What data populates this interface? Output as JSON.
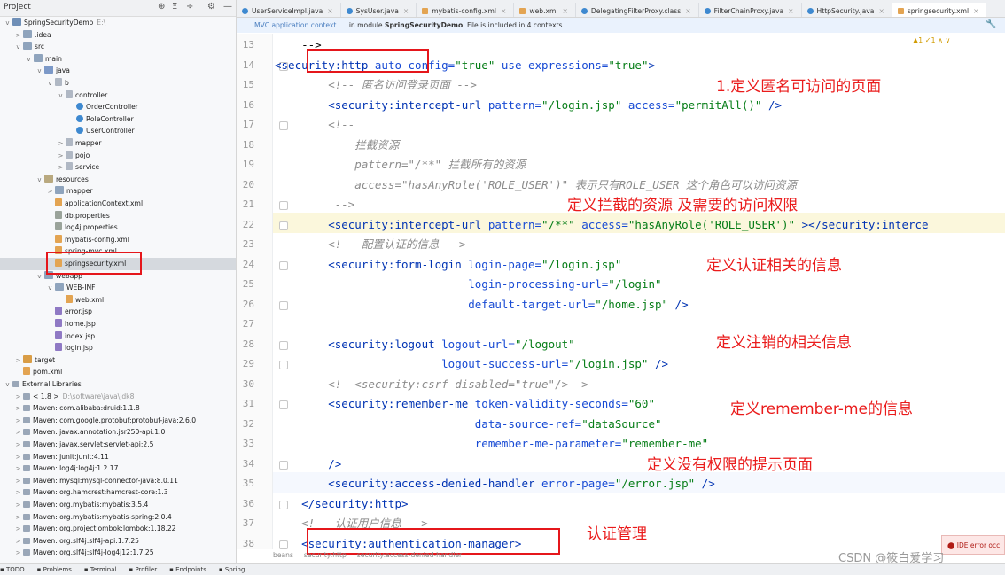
{
  "project_panel": {
    "header_title": "Project",
    "toolbar": [
      "⊕",
      "Ξ",
      "÷",
      "⚙",
      "—"
    ],
    "tree": [
      {
        "label": "SpringSecurityDemo",
        "suffix": "E:\\",
        "depth": 0,
        "icon": "module-folder",
        "twisty": "v"
      },
      {
        "label": ".idea",
        "depth": 1,
        "icon": "folder",
        "twisty": ">"
      },
      {
        "label": "src",
        "depth": 1,
        "icon": "folder",
        "twisty": "v"
      },
      {
        "label": "main",
        "depth": 2,
        "icon": "folder",
        "twisty": "v"
      },
      {
        "label": "java",
        "depth": 3,
        "icon": "source-folder",
        "twisty": "v"
      },
      {
        "label": "b",
        "depth": 4,
        "icon": "package",
        "twisty": "v"
      },
      {
        "label": "controller",
        "depth": 5,
        "icon": "package",
        "twisty": "v"
      },
      {
        "label": "OrderController",
        "depth": 6,
        "icon": "class"
      },
      {
        "label": "RoleController",
        "depth": 6,
        "icon": "class"
      },
      {
        "label": "UserController",
        "depth": 6,
        "icon": "class"
      },
      {
        "label": "mapper",
        "depth": 5,
        "icon": "package",
        "twisty": ">"
      },
      {
        "label": "pojo",
        "depth": 5,
        "icon": "package",
        "twisty": ">"
      },
      {
        "label": "service",
        "depth": 5,
        "icon": "package",
        "twisty": ">"
      },
      {
        "label": "resources",
        "depth": 3,
        "icon": "resources-folder",
        "twisty": "v"
      },
      {
        "label": "mapper",
        "depth": 4,
        "icon": "folder",
        "twisty": ">"
      },
      {
        "label": "applicationContext.xml",
        "depth": 4,
        "icon": "xml"
      },
      {
        "label": "db.properties",
        "depth": 4,
        "icon": "properties"
      },
      {
        "label": "log4j.properties",
        "depth": 4,
        "icon": "properties"
      },
      {
        "label": "mybatis-config.xml",
        "depth": 4,
        "icon": "xml"
      },
      {
        "label": "spring-mvc.xml",
        "depth": 4,
        "icon": "xml"
      },
      {
        "label": "springsecurity.xml",
        "depth": 4,
        "icon": "xml",
        "selected": true
      },
      {
        "label": "webapp",
        "depth": 3,
        "icon": "folder",
        "twisty": "v"
      },
      {
        "label": "WEB-INF",
        "depth": 4,
        "icon": "folder",
        "twisty": "v"
      },
      {
        "label": "web.xml",
        "depth": 5,
        "icon": "xml"
      },
      {
        "label": "error.jsp",
        "depth": 4,
        "icon": "jsp"
      },
      {
        "label": "home.jsp",
        "depth": 4,
        "icon": "jsp"
      },
      {
        "label": "index.jsp",
        "depth": 4,
        "icon": "jsp"
      },
      {
        "label": "login.jsp",
        "depth": 4,
        "icon": "jsp"
      },
      {
        "label": "target",
        "depth": 1,
        "icon": "target-folder",
        "twisty": ">"
      },
      {
        "label": "pom.xml",
        "depth": 1,
        "icon": "xml"
      },
      {
        "label": "External Libraries",
        "depth": 0,
        "icon": "library",
        "twisty": "v"
      },
      {
        "label": "< 1.8 >",
        "suffix": "D:\\software\\java\\jdk8",
        "depth": 1,
        "icon": "library",
        "twisty": ">"
      },
      {
        "label": "Maven: com.alibaba:druid:1.1.8",
        "depth": 1,
        "icon": "library",
        "twisty": ">"
      },
      {
        "label": "Maven: com.google.protobuf:protobuf-java:2.6.0",
        "depth": 1,
        "icon": "library",
        "twisty": ">"
      },
      {
        "label": "Maven: javax.annotation:jsr250-api:1.0",
        "depth": 1,
        "icon": "library",
        "twisty": ">"
      },
      {
        "label": "Maven: javax.servlet:servlet-api:2.5",
        "depth": 1,
        "icon": "library",
        "twisty": ">"
      },
      {
        "label": "Maven: junit:junit:4.11",
        "depth": 1,
        "icon": "library",
        "twisty": ">"
      },
      {
        "label": "Maven: log4j:log4j:1.2.17",
        "depth": 1,
        "icon": "library",
        "twisty": ">"
      },
      {
        "label": "Maven: mysql:mysql-connector-java:8.0.11",
        "depth": 1,
        "icon": "library",
        "twisty": ">"
      },
      {
        "label": "Maven: org.hamcrest:hamcrest-core:1.3",
        "depth": 1,
        "icon": "library",
        "twisty": ">"
      },
      {
        "label": "Maven: org.mybatis:mybatis:3.5.4",
        "depth": 1,
        "icon": "library",
        "twisty": ">"
      },
      {
        "label": "Maven: org.mybatis:mybatis-spring:2.0.4",
        "depth": 1,
        "icon": "library",
        "twisty": ">"
      },
      {
        "label": "Maven: org.projectlombok:lombok:1.18.22",
        "depth": 1,
        "icon": "library",
        "twisty": ">"
      },
      {
        "label": "Maven: org.slf4j:slf4j-api:1.7.25",
        "depth": 1,
        "icon": "library",
        "twisty": ">"
      },
      {
        "label": "Maven: org.slf4j:slf4j-log4j12:1.7.25",
        "depth": 1,
        "icon": "library",
        "twisty": ">"
      }
    ]
  },
  "tabs": [
    {
      "label": "UserServiceImpl.java",
      "icon": "class"
    },
    {
      "label": "SysUser.java",
      "icon": "class"
    },
    {
      "label": "mybatis-config.xml",
      "icon": "xml"
    },
    {
      "label": "web.xml",
      "icon": "xml"
    },
    {
      "label": "DelegatingFilterProxy.class",
      "icon": "class"
    },
    {
      "label": "FilterChainProxy.java",
      "icon": "class"
    },
    {
      "label": "HttpSecurity.java",
      "icon": "class"
    },
    {
      "label": "springsecurity.xml",
      "icon": "xml",
      "active": true
    }
  ],
  "notification": {
    "context": "MVC application context",
    "prefix": "in module ",
    "module": "SpringSecurityDemo",
    "suffix": ". File is included in 4 contexts."
  },
  "inspection": "▲1 ✓1 ∧ ∨",
  "code_lines": [
    {
      "n": 13,
      "parts": [
        [
          "plain",
          "    -->"
        ]
      ]
    },
    {
      "n": 14,
      "parts": [
        [
          "tag",
          "<security:http "
        ],
        [
          "attr",
          "auto-config="
        ],
        [
          "val",
          "\"true\" "
        ],
        [
          "attr",
          "use-expressions="
        ],
        [
          "val",
          "\"true\""
        ],
        [
          "tag",
          ">"
        ]
      ]
    },
    {
      "n": 15,
      "parts": [
        [
          "cm",
          "        <!-- 匿名访问登录页面 -->"
        ]
      ]
    },
    {
      "n": 16,
      "parts": [
        [
          "tag",
          "        <security:intercept-url "
        ],
        [
          "attr",
          "pattern="
        ],
        [
          "val",
          "\"/login.jsp\" "
        ],
        [
          "attr",
          "access="
        ],
        [
          "val",
          "\"permitAll()\" "
        ],
        [
          "tag",
          "/>"
        ]
      ]
    },
    {
      "n": 17,
      "parts": [
        [
          "cm",
          "        <!--"
        ]
      ]
    },
    {
      "n": 18,
      "parts": [
        [
          "cm",
          "            拦截资源"
        ]
      ]
    },
    {
      "n": 19,
      "parts": [
        [
          "cm",
          "            pattern=\"/**\" 拦截所有的资源"
        ]
      ]
    },
    {
      "n": 20,
      "parts": [
        [
          "cm",
          "            access=\"hasAnyRole('ROLE_USER')\" 表示只有ROLE_USER 这个角色可以访问资源"
        ]
      ]
    },
    {
      "n": 21,
      "parts": [
        [
          "cm",
          "         -->"
        ]
      ]
    },
    {
      "n": 22,
      "parts": [
        [
          "tag",
          "        <security:intercept-url "
        ],
        [
          "attr",
          "pattern="
        ],
        [
          "val",
          "\"/**\" "
        ],
        [
          "attr",
          "access="
        ],
        [
          "val",
          "\"hasAnyRole('ROLE_USER')\" "
        ],
        [
          "tag",
          "></security:interce"
        ]
      ]
    },
    {
      "n": 23,
      "parts": [
        [
          "cm",
          "        <!-- 配置认证的信息 -->"
        ]
      ]
    },
    {
      "n": 24,
      "parts": [
        [
          "tag",
          "        <security:form-login "
        ],
        [
          "attr",
          "login-page="
        ],
        [
          "val",
          "\"/login.jsp\""
        ]
      ]
    },
    {
      "n": 25,
      "parts": [
        [
          "attr",
          "                             login-processing-url="
        ],
        [
          "val",
          "\"/login\""
        ]
      ]
    },
    {
      "n": 26,
      "parts": [
        [
          "attr",
          "                             default-target-url="
        ],
        [
          "val",
          "\"/home.jsp\" "
        ],
        [
          "tag",
          "/>"
        ]
      ]
    },
    {
      "n": 27,
      "parts": [
        [
          "plain",
          ""
        ]
      ]
    },
    {
      "n": 28,
      "parts": [
        [
          "tag",
          "        <security:logout "
        ],
        [
          "attr",
          "logout-url="
        ],
        [
          "val",
          "\"/logout\""
        ]
      ]
    },
    {
      "n": 29,
      "parts": [
        [
          "attr",
          "                         logout-success-url="
        ],
        [
          "val",
          "\"/login.jsp\" "
        ],
        [
          "tag",
          "/>"
        ]
      ]
    },
    {
      "n": 30,
      "parts": [
        [
          "cm",
          "        <!--<security:csrf disabled=\"true\"/>-->"
        ]
      ]
    },
    {
      "n": 31,
      "parts": [
        [
          "tag",
          "        <security:remember-me "
        ],
        [
          "attr",
          "token-validity-seconds="
        ],
        [
          "val",
          "\"60\""
        ]
      ]
    },
    {
      "n": 32,
      "parts": [
        [
          "attr",
          "                              data-source-ref="
        ],
        [
          "val",
          "\"dataSource\""
        ]
      ]
    },
    {
      "n": 33,
      "parts": [
        [
          "attr",
          "                              remember-me-parameter="
        ],
        [
          "val",
          "\"remember-me\""
        ]
      ]
    },
    {
      "n": 34,
      "parts": [
        [
          "tag",
          "        />"
        ]
      ]
    },
    {
      "n": 35,
      "parts": [
        [
          "tag",
          "        <security:access-denied-handler "
        ],
        [
          "attr",
          "error-page="
        ],
        [
          "val",
          "\"/error.jsp\" "
        ],
        [
          "tag",
          "/>"
        ]
      ]
    },
    {
      "n": 36,
      "parts": [
        [
          "tag",
          "    </security:http>"
        ]
      ]
    },
    {
      "n": 37,
      "parts": [
        [
          "cm",
          "    <!-- 认证用户信息 -->"
        ]
      ]
    },
    {
      "n": 38,
      "parts": [
        [
          "tag",
          "    <security:authentication-manager>"
        ]
      ]
    }
  ],
  "annotations": [
    "1.定义匿名可访问的页面",
    "定义拦截的资源 及需要的访问权限",
    "定义认证相关的信息",
    "定义注销的相关信息",
    "定义remember-me的信息",
    "定义没有权限的提示页面",
    "认证管理"
  ],
  "breadcrumb": [
    "beans",
    "security:http",
    "security:access-denied-handler"
  ],
  "status_bar": [
    "TODO",
    "Problems",
    "Terminal",
    "Profiler",
    "Endpoints",
    "Spring"
  ],
  "ide_error": "IDE error occ",
  "watermark": "CSDN @筱白爱学习",
  "colors": {
    "annotation": "#ea1b1b",
    "tag": "#0033b3",
    "attr": "#174ad4",
    "value": "#067d17",
    "comment": "#8c8c8c"
  }
}
